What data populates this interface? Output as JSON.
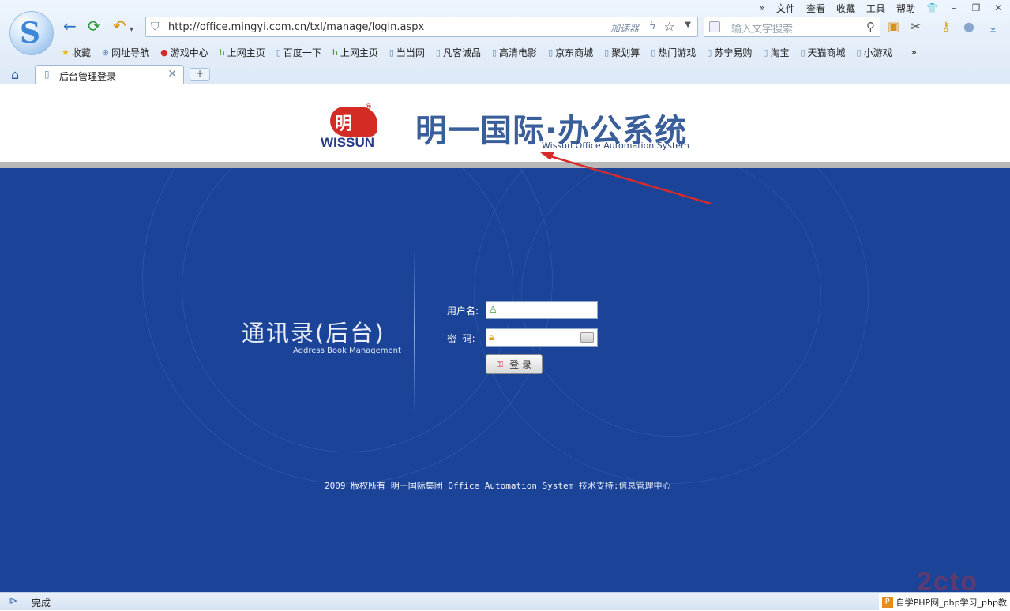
{
  "browser": {
    "menu": [
      "文件",
      "查看",
      "收藏",
      "工具",
      "帮助"
    ],
    "address_url": "http://office.mingyi.com.cn/txl/manage/login.aspx",
    "accelerator_label": "加速器",
    "search_placeholder": "输入文字搜索",
    "favorites": [
      "收藏",
      "网址导航",
      "游戏中心",
      "上网主页",
      "百度一下",
      "上网主页",
      "当当网",
      "凡客诚品",
      "高清电影",
      "京东商城",
      "聚划算",
      "热门游戏",
      "苏宁易购",
      "淘宝",
      "天猫商城",
      "小游戏"
    ],
    "tab_title": "后台管理登录",
    "status_text": "完成",
    "watermark_text": "自学PHP网_php学习_php教"
  },
  "header": {
    "logo_char": "明",
    "logo_brand": "WISSUN",
    "title_cn": "明一国际·办公系统",
    "title_en": "Wissun Office Automation System"
  },
  "login": {
    "app_title_cn": "通讯录(后台)",
    "app_title_en": "Address Book Management",
    "username_label": "用户名:",
    "password_label": "密  码:",
    "username_value": "",
    "password_value": "",
    "login_button": "登 录",
    "copyright": "2009 版权所有 明一国际集团 Office Automation System   技术支持:信息管理中心"
  },
  "colors": {
    "page_bg": "#1b4499",
    "annotation_arrow": "#d62b2b"
  }
}
